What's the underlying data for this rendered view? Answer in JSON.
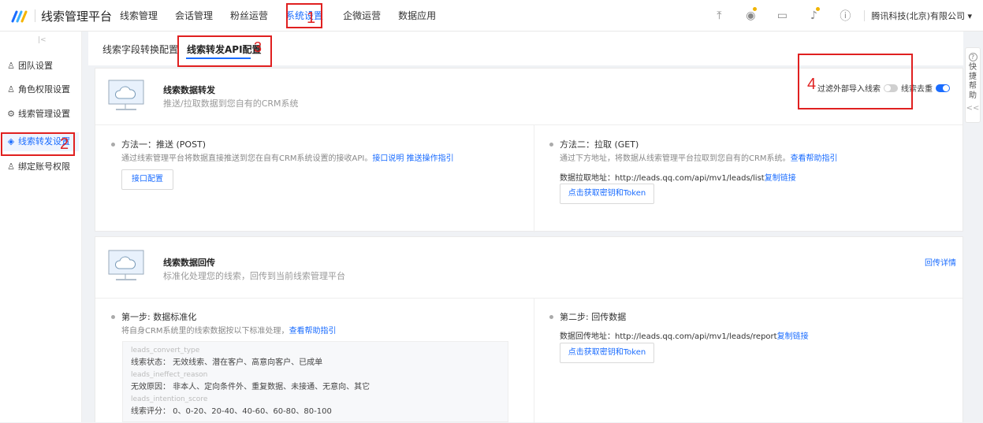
{
  "header": {
    "app_title": "线索管理平台",
    "nav": [
      "线索管理",
      "会话管理",
      "粉丝运营",
      "系统设置",
      "企微运营",
      "数据应用"
    ],
    "active_nav": "系统设置",
    "company": "腾讯科技(北京)有限公司",
    "icons": [
      "upload-icon",
      "badge-icon",
      "document-icon",
      "bell-icon",
      "help-icon"
    ]
  },
  "annotations": {
    "n1": "1",
    "n2": "2",
    "n3": "3",
    "n4": "4"
  },
  "sidebar": {
    "collapse": "|<",
    "items": [
      {
        "icon": "team-icon",
        "label": "团队设置"
      },
      {
        "icon": "role-icon",
        "label": "角色权限设置"
      },
      {
        "icon": "gear-icon",
        "label": "线索管理设置"
      },
      {
        "icon": "forward-icon",
        "label": "线索转发设置"
      },
      {
        "icon": "bind-icon",
        "label": "绑定账号权限"
      }
    ]
  },
  "tabs": [
    "线索字段转换配置",
    "线索转发API配置"
  ],
  "helper": {
    "chars": [
      "快",
      "捷",
      "帮",
      "助"
    ],
    "q": "?",
    "collapse": "<<"
  },
  "forward_card": {
    "title": "线索数据转发",
    "subtitle": "推送/拉取数据到您自有的CRM系统",
    "filter_label": "过滤外部导入线索",
    "filter_on": false,
    "dedupe_label": "线索去重",
    "dedupe_on": true,
    "method1": {
      "title": "方法一：推送 (POST)",
      "desc": "通过线索管理平台将数据直接推送到您在自有CRM系统设置的接收API。",
      "link1": "接口说明",
      "link2": "推送操作指引",
      "button": "接口配置"
    },
    "method2": {
      "title": "方法二：拉取 (GET)",
      "desc": "通过下方地址，将数据从线索管理平台拉取到您自有的CRM系统。",
      "link": "查看帮助指引",
      "addr_label": "数据拉取地址：",
      "addr": "http://leads.qq.com/api/mv1/leads/list",
      "copy": "复制链接",
      "button": "点击获取密钥和Token"
    }
  },
  "return_card": {
    "title": "线索数据回传",
    "subtitle": "标准化处理您的线索，回传到当前线索管理平台",
    "detail_link": "回传详情",
    "step1": {
      "title": "第一步: 数据标准化",
      "desc": "将自身CRM系统里的线索数据按以下标准处理，",
      "link": "查看帮助指引",
      "rows": [
        {
          "k": "leads_convert_type",
          "v": "线索状态：  无效线索、潜在客户、高意向客户、已成单"
        },
        {
          "k": "leads_ineffect_reason",
          "v": "无效原因：  非本人、定向条件外、重复数据、未接通、无意向、其它"
        },
        {
          "k": "leads_intention_score",
          "v": "线索评分：  0、0-20、20-40、40-60、60-80、80-100"
        }
      ]
    },
    "step2": {
      "title": "第二步: 回传数据",
      "addr_label": "数据回传地址：",
      "addr": "http://leads.qq.com/api/mv1/leads/report",
      "copy": "复制链接",
      "button": "点击获取密钥和Token"
    }
  }
}
